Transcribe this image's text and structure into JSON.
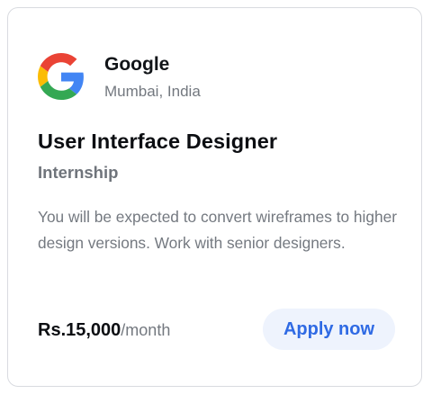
{
  "company": {
    "name": "Google",
    "location": "Mumbai, India",
    "logo_icon": "google-logo-icon"
  },
  "job": {
    "title": "User Interface Designer",
    "type": "Internship",
    "description": "You will be expected to convert wireframes to higher design versions. Work with senior designers."
  },
  "salary": {
    "amount": "Rs.15,000",
    "period": "/month"
  },
  "actions": {
    "apply_label": "Apply now"
  },
  "colors": {
    "accent": "#2f6ae4",
    "button_background": "#eef3fd",
    "google_blue": "#4285F4",
    "google_red": "#EA4335",
    "google_yellow": "#FBBC05",
    "google_green": "#34A853"
  }
}
